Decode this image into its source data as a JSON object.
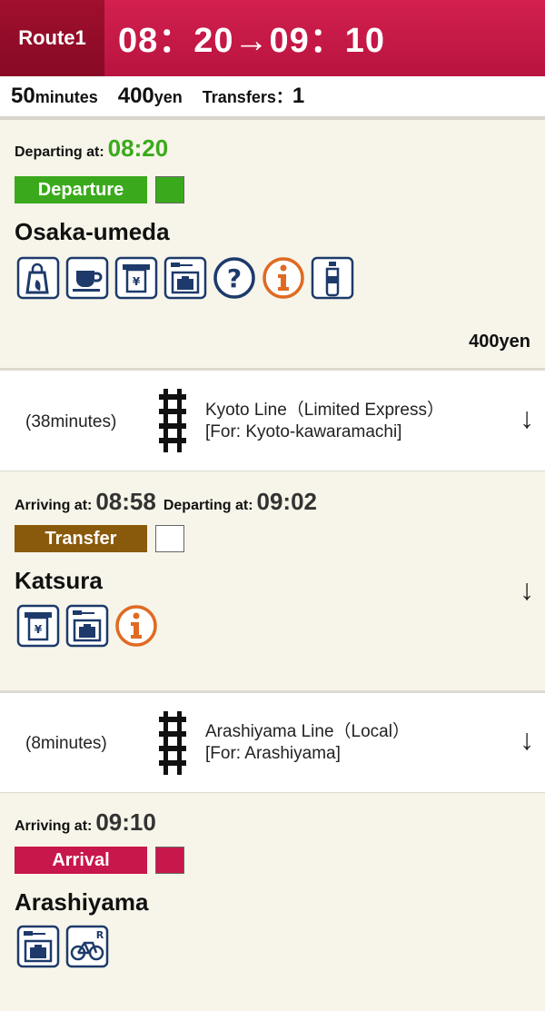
{
  "header": {
    "route_label": "Route1",
    "times": "08：20→09：10"
  },
  "summary": {
    "duration_value": "50",
    "duration_unit": "minutes",
    "fare_value": "400",
    "fare_unit": "yen",
    "transfers_label": "Transfers：",
    "transfers_value": "1"
  },
  "stops": [
    {
      "departing_label": "Departing at:",
      "departing_time": "08:20",
      "badge": "Departure",
      "badge_color": "#3aaa1c",
      "name": "Osaka-umeda",
      "fare": "400yen",
      "facilities": [
        "shop-icon",
        "cafe-icon",
        "atm-icon",
        "locker-icon",
        "help-icon",
        "info-icon",
        "bottle-icon"
      ]
    },
    {
      "arriving_label": "Arriving at:",
      "arriving_time": "08:58",
      "departing_label": "Departing at:",
      "departing_time": "09:02",
      "badge": "Transfer",
      "badge_color": "#8a5a0c",
      "name": "Katsura",
      "arrow": "↓",
      "facilities": [
        "atm-icon",
        "locker-icon",
        "info-icon"
      ]
    },
    {
      "arriving_label": "Arriving at:",
      "arriving_time": "09:10",
      "badge": "Arrival",
      "badge_color": "#c8174a",
      "name": "Arashiyama",
      "facilities": [
        "locker-icon",
        "bicycle-rental-icon"
      ]
    }
  ],
  "segments": [
    {
      "duration": "(38minutes)",
      "line": "Kyoto Line（Limited Express）",
      "destination": "[For: Kyoto-kawaramachi]",
      "arrow": "↓"
    },
    {
      "duration": "(8minutes)",
      "line": "Arashiyama Line（Local）",
      "destination": "[For: Arashiyama]",
      "arrow": "↓"
    }
  ]
}
